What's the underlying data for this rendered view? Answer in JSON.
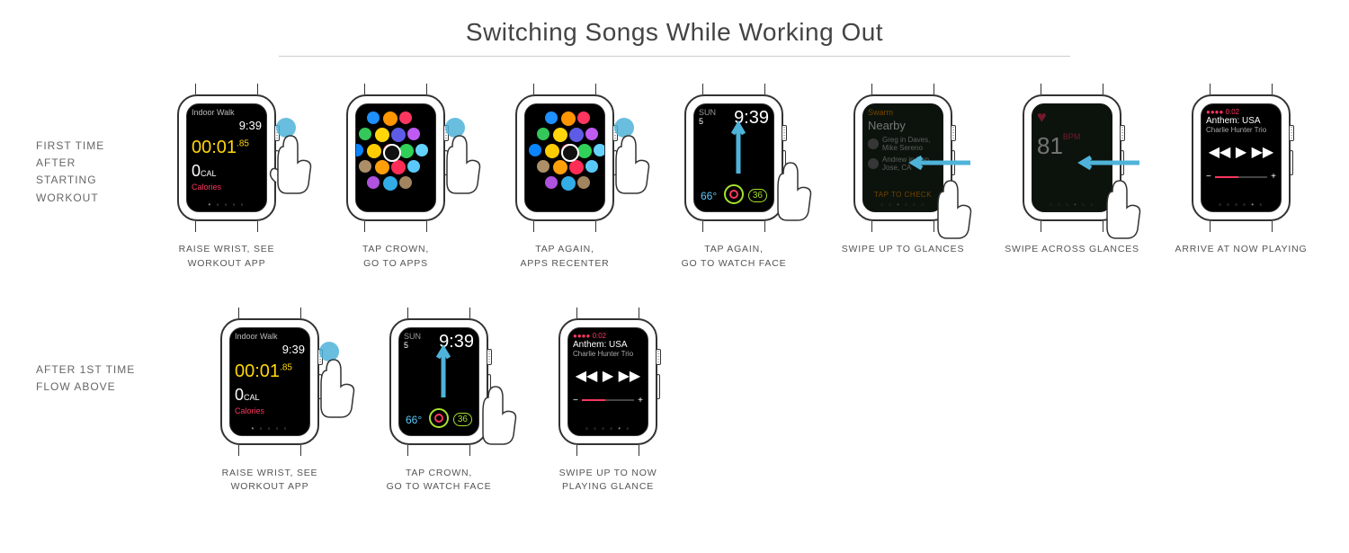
{
  "title": "Switching Songs While Working Out",
  "flows": [
    {
      "label": "FIRST TIME AFTER\nSTARTING WORKOUT",
      "steps": [
        {
          "caption": "RAISE WRIST, SEE\nWORKOUT APP"
        },
        {
          "caption": "TAP CROWN,\nGO TO APPS"
        },
        {
          "caption": "TAP AGAIN,\nAPPS RECENTER"
        },
        {
          "caption": "TAP AGAIN,\nGO TO WATCH FACE"
        },
        {
          "caption": "SWIPE UP TO GLANCES"
        },
        {
          "caption": "SWIPE ACROSS GLANCES"
        },
        {
          "caption": "ARRIVE AT NOW PLAYING"
        }
      ]
    },
    {
      "label": "AFTER 1ST TIME\nFLOW ABOVE",
      "steps": [
        {
          "caption": "RAISE WRIST, SEE\nWORKOUT APP"
        },
        {
          "caption": "TAP CROWN,\nGO TO WATCH FACE"
        },
        {
          "caption": "SWIPE UP TO NOW\nPLAYING GLANCE"
        }
      ]
    }
  ],
  "workout": {
    "mode": "Indoor Walk",
    "clock": "9:39",
    "elapsed": "00:01",
    "elapsed_frac": ".85",
    "cal_value": "0",
    "cal_unit": "CAL",
    "cal_label": "Calories"
  },
  "watchface": {
    "weekday": "SUN",
    "day": "5",
    "time": "9:39",
    "temp": "66°",
    "battery": "36"
  },
  "swarm": {
    "app": "Swarm",
    "header": "Nearby",
    "line1": "Greg in Daves,",
    "line2": "Mike Sereno",
    "line3": "Andrew in San",
    "line4": "Jose, CA",
    "cta": "TAP TO CHECK"
  },
  "heart": {
    "value": "81",
    "unit": "BPM"
  },
  "nowplaying": {
    "source_label": "0:02",
    "song": "Anthem: USA",
    "artist": "Charlie Hunter Trio",
    "vol_minus": "−",
    "vol_plus": "+"
  }
}
